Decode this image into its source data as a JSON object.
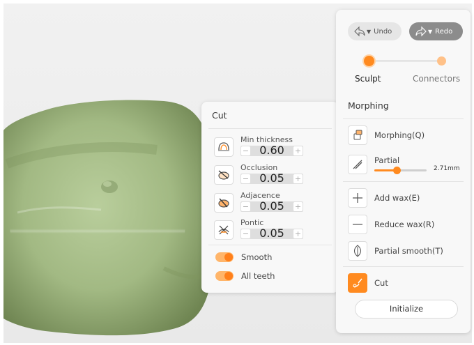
{
  "cut_panel": {
    "title": "Cut",
    "params": [
      {
        "label": "Min thickness",
        "value": "0.60",
        "icon": "min-thickness-icon"
      },
      {
        "label": "Occlusion",
        "value": "0.05",
        "icon": "occlusion-icon"
      },
      {
        "label": "Adjacence",
        "value": "0.05",
        "icon": "adjacence-icon"
      },
      {
        "label": "Pontic",
        "value": "0.05",
        "icon": "pontic-icon"
      }
    ],
    "toggles": [
      {
        "label": "Smooth",
        "on": true
      },
      {
        "label": "All teeth",
        "on": true
      }
    ]
  },
  "history": {
    "undo_label": "Undo",
    "redo_label": "Redo"
  },
  "steps": {
    "sculpt": "Sculpt",
    "connectors": "Connectors",
    "active": "Sculpt"
  },
  "tools_panel": {
    "title": "Morphing",
    "morphing": "Morphing(Q)",
    "partial": "Partial",
    "partial_value": "2.71mm",
    "partial_fraction": 0.43,
    "add_wax": "Add wax(E)",
    "reduce_wax": "Reduce wax(R)",
    "partial_smooth": "Partial smooth(T)",
    "cut": "Cut",
    "initialize": "Initialize"
  },
  "colors": {
    "accent": "#ff8a1f",
    "tooth": "#a9c08a"
  }
}
